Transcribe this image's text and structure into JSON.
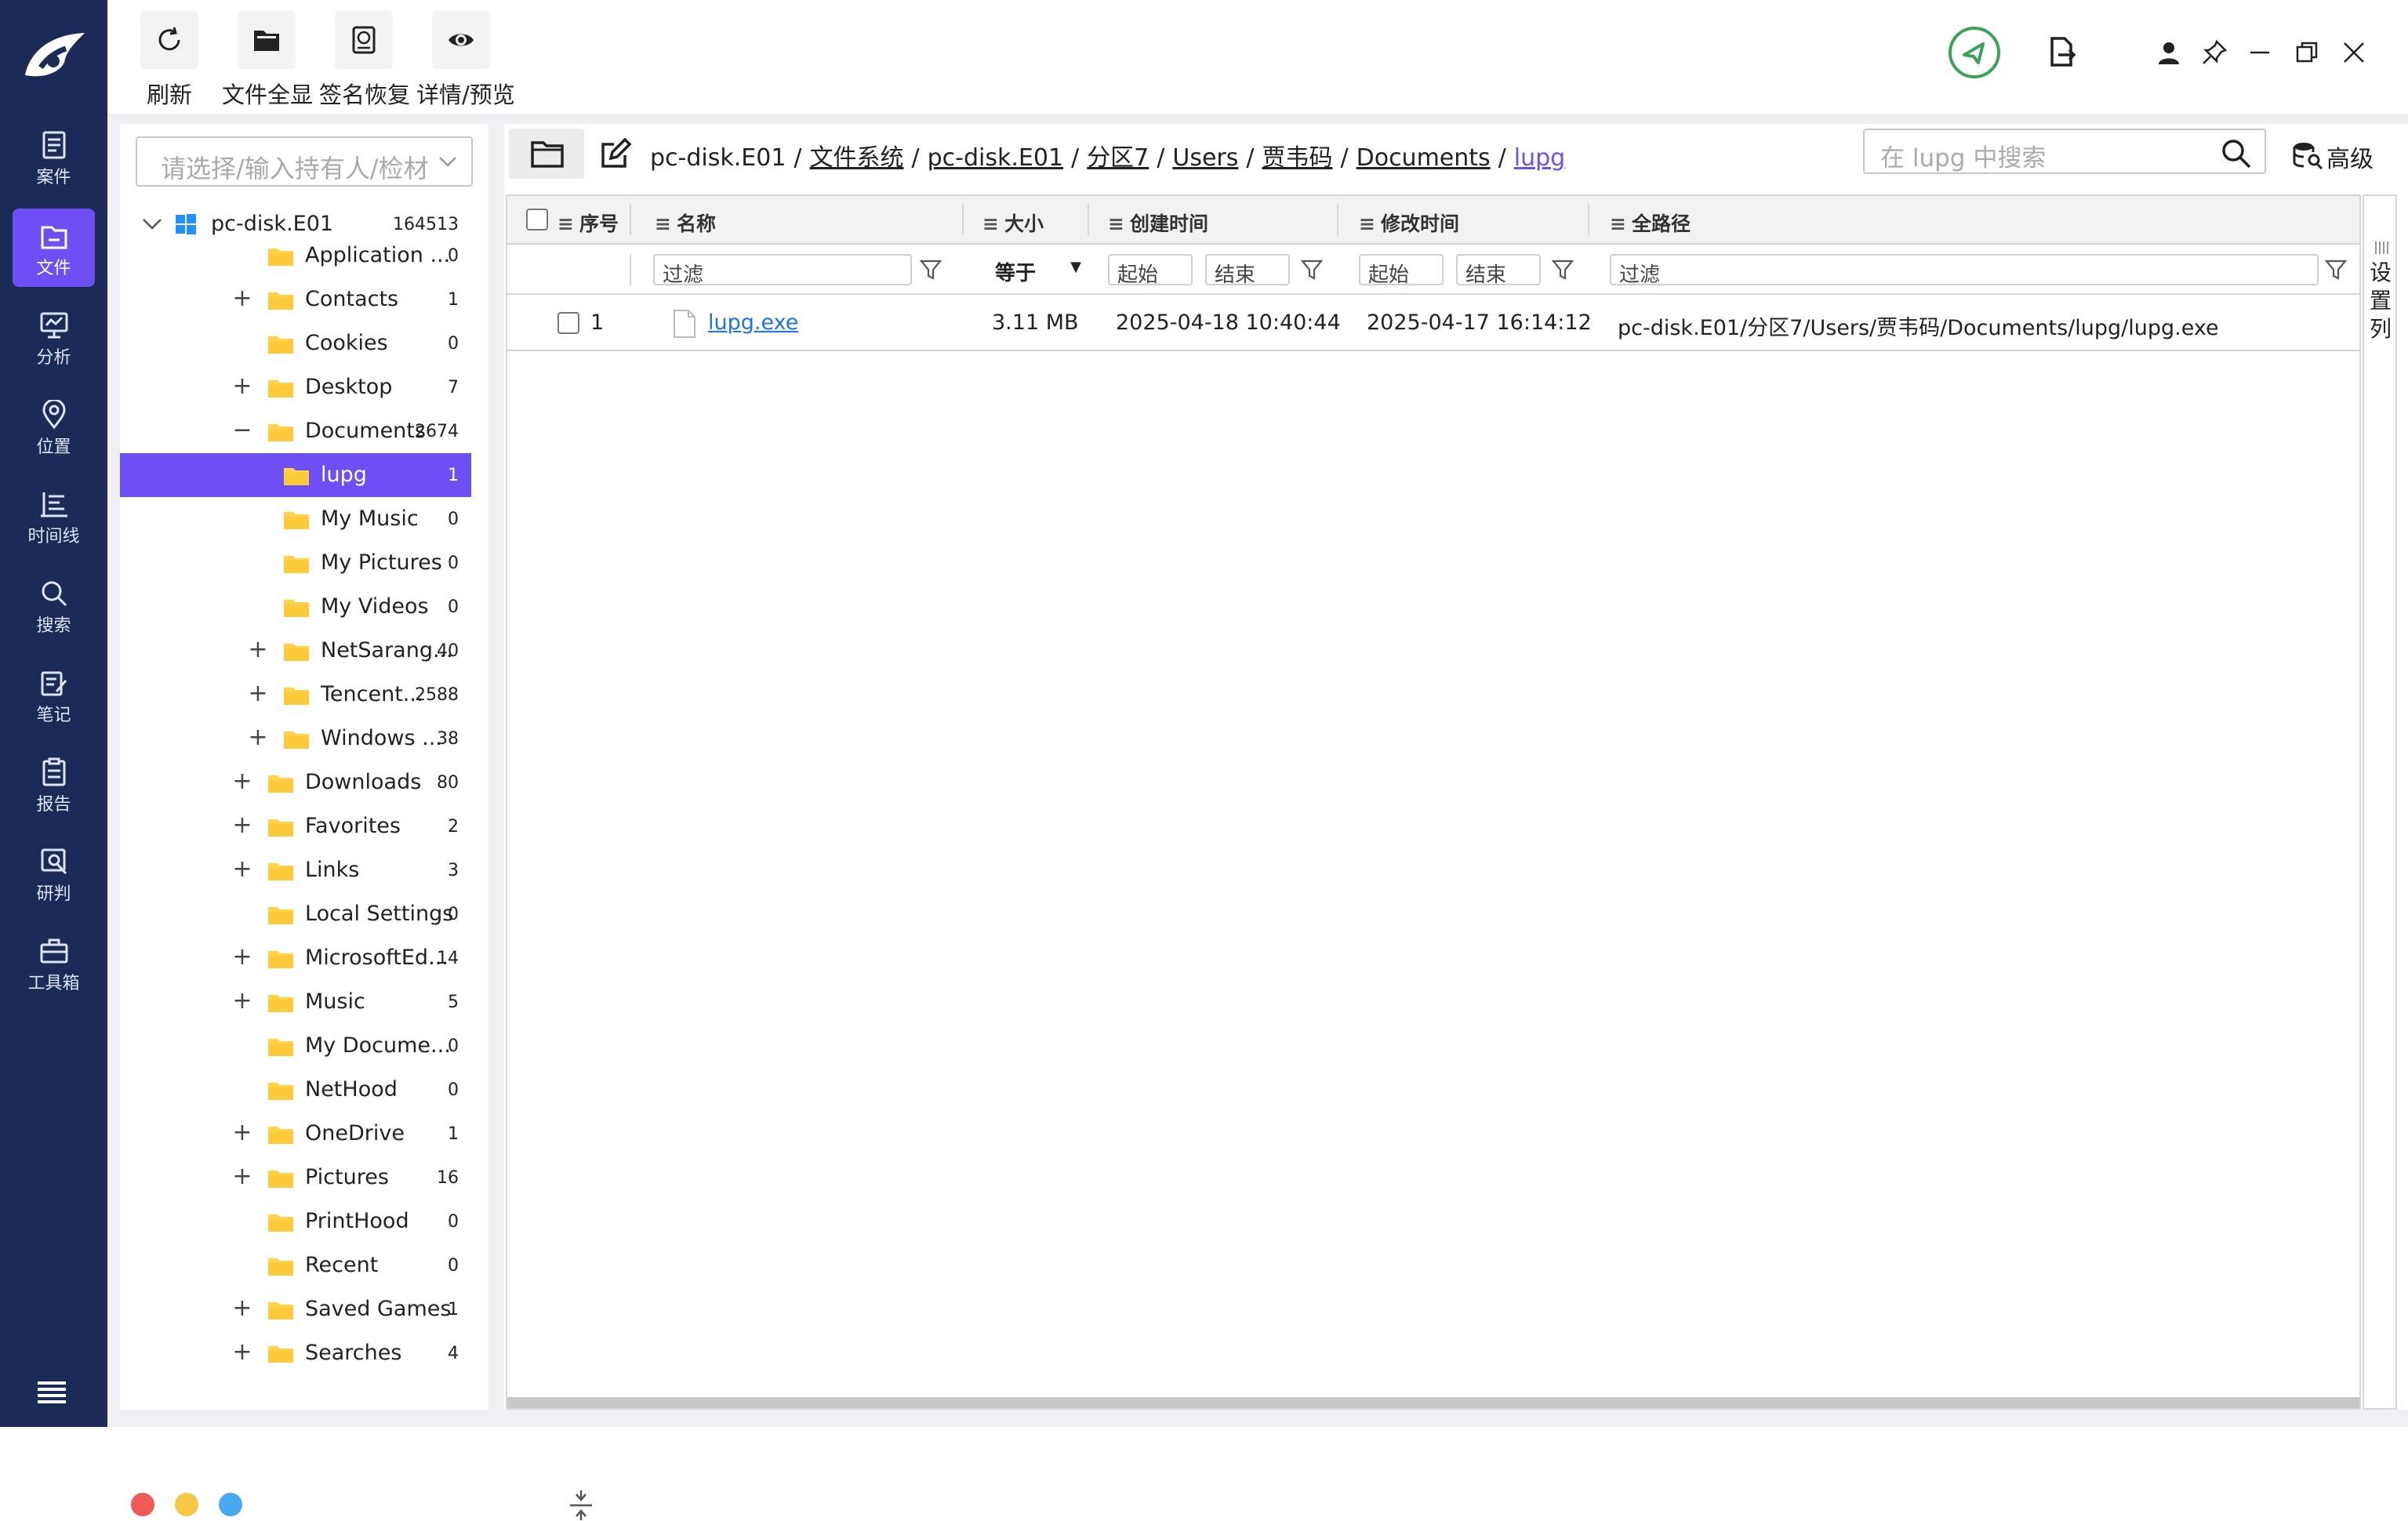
{
  "nav": {
    "items": [
      {
        "label": "案件",
        "icon": "case-icon"
      },
      {
        "label": "文件",
        "icon": "file-icon",
        "active": true
      },
      {
        "label": "分析",
        "icon": "analysis-icon"
      },
      {
        "label": "位置",
        "icon": "location-icon"
      },
      {
        "label": "时间线",
        "icon": "timeline-icon"
      },
      {
        "label": "搜索",
        "icon": "search-icon"
      },
      {
        "label": "笔记",
        "icon": "note-icon"
      },
      {
        "label": "报告",
        "icon": "report-icon"
      },
      {
        "label": "研判",
        "icon": "judge-icon"
      },
      {
        "label": "工具箱",
        "icon": "toolbox-icon"
      }
    ]
  },
  "toolbar": {
    "refresh_label": "刷新",
    "show_all_label": "文件全显",
    "signature_label": "签名恢复",
    "preview_label": "详情/预览"
  },
  "left": {
    "owner_placeholder": "请选择/输入持有人/检材",
    "root": {
      "label": "pc-disk.E01",
      "count": "164513"
    },
    "nodes": [
      {
        "label": "Application ...",
        "count": "0",
        "exp": "",
        "indent": 1
      },
      {
        "label": "Contacts",
        "count": "1",
        "exp": "+",
        "indent": 1
      },
      {
        "label": "Cookies",
        "count": "0",
        "exp": "",
        "indent": 1
      },
      {
        "label": "Desktop",
        "count": "7",
        "exp": "+",
        "indent": 1
      },
      {
        "label": "Documents",
        "count": "2674",
        "exp": "−",
        "indent": 1
      },
      {
        "label": "lupg",
        "count": "1",
        "exp": "",
        "indent": 2,
        "selected": true
      },
      {
        "label": "My Music",
        "count": "0",
        "exp": "",
        "indent": 2
      },
      {
        "label": "My Pictures",
        "count": "0",
        "exp": "",
        "indent": 2
      },
      {
        "label": "My Videos",
        "count": "0",
        "exp": "",
        "indent": 2
      },
      {
        "label": "NetSarang...",
        "count": "40",
        "exp": "+",
        "indent": 2
      },
      {
        "label": "Tencent...",
        "count": "2588",
        "exp": "+",
        "indent": 2
      },
      {
        "label": "Windows ...",
        "count": "38",
        "exp": "+",
        "indent": 2
      },
      {
        "label": "Downloads",
        "count": "80",
        "exp": "+",
        "indent": 1
      },
      {
        "label": "Favorites",
        "count": "2",
        "exp": "+",
        "indent": 1
      },
      {
        "label": "Links",
        "count": "3",
        "exp": "+",
        "indent": 1
      },
      {
        "label": "Local Settings",
        "count": "0",
        "exp": "",
        "indent": 1
      },
      {
        "label": "MicrosoftEd...",
        "count": "14",
        "exp": "+",
        "indent": 1
      },
      {
        "label": "Music",
        "count": "5",
        "exp": "+",
        "indent": 1
      },
      {
        "label": "My Docume...",
        "count": "0",
        "exp": "",
        "indent": 1
      },
      {
        "label": "NetHood",
        "count": "0",
        "exp": "",
        "indent": 1
      },
      {
        "label": "OneDrive",
        "count": "1",
        "exp": "+",
        "indent": 1
      },
      {
        "label": "Pictures",
        "count": "16",
        "exp": "+",
        "indent": 1
      },
      {
        "label": "PrintHood",
        "count": "0",
        "exp": "",
        "indent": 1
      },
      {
        "label": "Recent",
        "count": "0",
        "exp": "",
        "indent": 1
      },
      {
        "label": "Saved Games",
        "count": "1",
        "exp": "+",
        "indent": 1
      },
      {
        "label": "Searches",
        "count": "4",
        "exp": "+",
        "indent": 1
      }
    ]
  },
  "breadcrumb": [
    "pc-disk.E01",
    "文件系统",
    "pc-disk.E01",
    "分区7",
    "Users",
    "贾韦码",
    "Documents",
    "lupg"
  ],
  "search": {
    "placeholder": "在 lupg 中搜索"
  },
  "advanced_label": "高级",
  "table": {
    "headers": {
      "index": "序号",
      "name": "名称",
      "size": "大小",
      "created": "创建时间",
      "modified": "修改时间",
      "path": "全路径"
    },
    "filters": {
      "name": "过滤",
      "size_op": "等于",
      "start1": "起始",
      "end1": "结束",
      "start2": "起始",
      "end2": "结束",
      "path": "过滤"
    },
    "rows": [
      {
        "index": "1",
        "name": "lupg.exe",
        "size": "3.11 MB",
        "created": "2025-04-18 10:40:44",
        "modified": "2025-04-17 16:14:12",
        "path": "pc-disk.E01/分区7/Users/贾韦码/Documents/lupg/lupg.exe"
      }
    ]
  },
  "side_column_label": "设置列",
  "colors": {
    "nav_bg": "#1c2a58",
    "accent": "#6e4ff4",
    "link": "#1a73e8",
    "status_ok": "#3aa35a"
  }
}
